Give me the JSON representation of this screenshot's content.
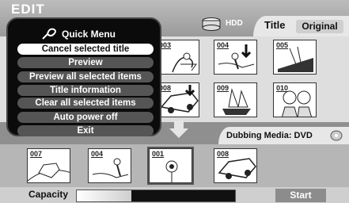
{
  "header": {
    "title": "EDIT",
    "hdd_label": "HDD",
    "title_tab": "Title",
    "original_tab": "Original"
  },
  "grid": {
    "thumbnails": [
      {
        "num": "003",
        "label": "bird"
      },
      {
        "num": "004",
        "label": "fisherman"
      },
      {
        "num": "005",
        "label": "ship-deck"
      },
      {
        "num": "008",
        "label": "car"
      },
      {
        "num": "009",
        "label": "sailing-ship"
      },
      {
        "num": "010",
        "label": "people"
      }
    ]
  },
  "dubbing": {
    "label": "Dubbing Media: DVD"
  },
  "bottom_thumbs": [
    {
      "num": "007",
      "label": "car-road"
    },
    {
      "num": "004",
      "label": "fisherman"
    },
    {
      "num": "001",
      "label": "flower"
    },
    {
      "num": "008",
      "label": "car"
    }
  ],
  "capacity": {
    "label": "Capacity",
    "used_fraction": 0.35
  },
  "start_button": "Start",
  "quick_menu": {
    "title": "Quick Menu",
    "items": [
      "Cancel selected title",
      "Preview",
      "Preview all selected items",
      "Title information",
      "Clear all selected items",
      "Auto power off",
      "Exit"
    ],
    "active_index": 0
  }
}
